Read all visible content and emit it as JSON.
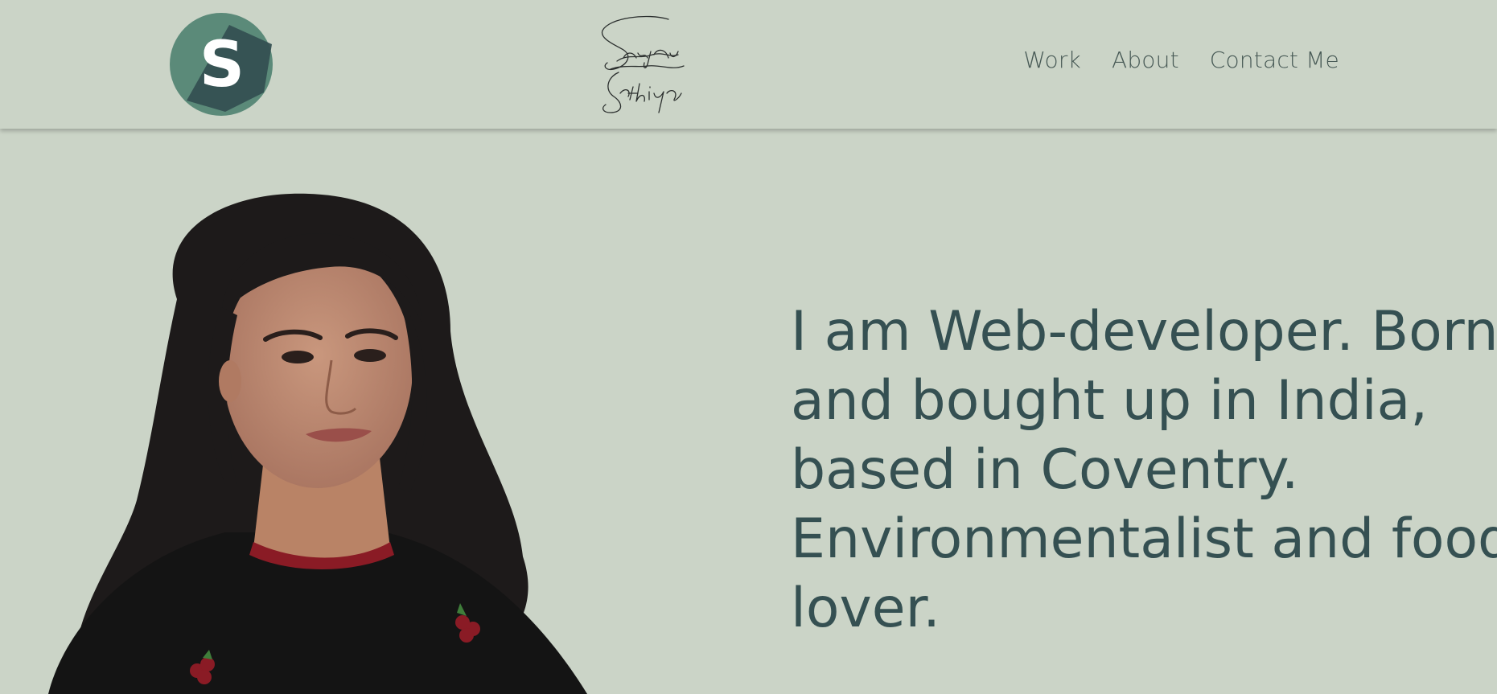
{
  "colors": {
    "background": "#cbd4c7",
    "accent_dark": "#355052",
    "logo_green": "#5b8a79",
    "nav_text": "#485a56"
  },
  "header": {
    "logo_letter": "S",
    "logo_icon": "s-monogram-logo",
    "signature_icon": "handwritten-signature",
    "nav": [
      {
        "label": "Work"
      },
      {
        "label": "About"
      },
      {
        "label": "Contact Me"
      }
    ]
  },
  "hero": {
    "portrait_icon": "profile-photo",
    "intro_text": "I am Web-developer. Born\nand bought up in India,\nbased in Coventry.\nEnvironmentalist and food\nlover."
  }
}
